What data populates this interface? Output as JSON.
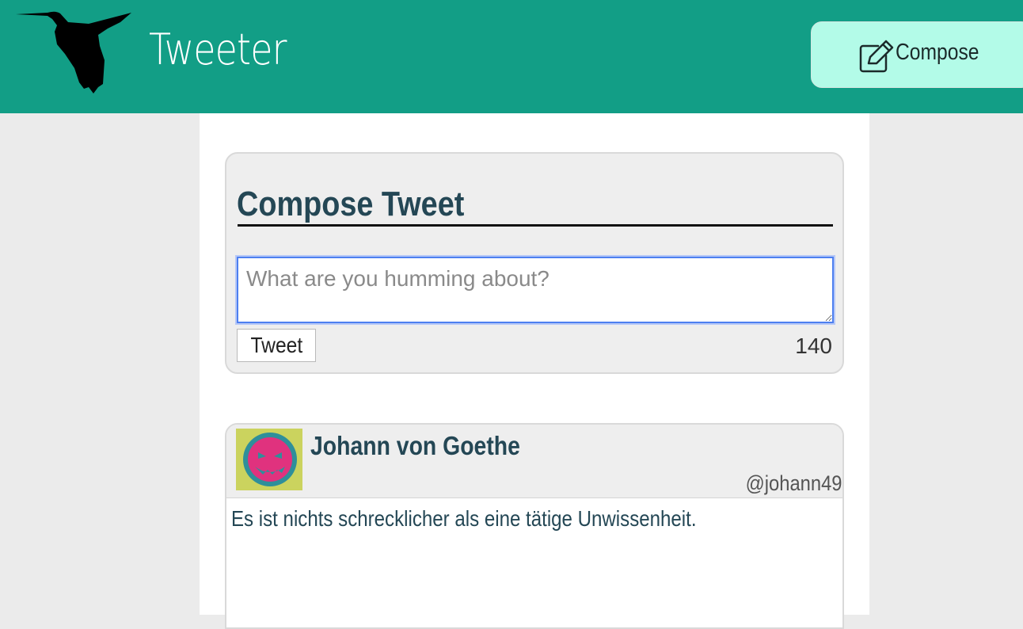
{
  "navbar": {
    "brand": "Tweeter",
    "logo_icon": "hummingbird-icon",
    "compose_button": {
      "label": "Compose",
      "icon": "pencil-square-icon"
    },
    "background_color": "#129e86",
    "compose_button_color": "#b3fbe8"
  },
  "compose_form": {
    "title": "Compose Tweet",
    "placeholder": "What are you humming about?",
    "value": "",
    "submit_label": "Tweet",
    "char_counter": "140"
  },
  "tweets": [
    {
      "author_name": "Johann von Goethe",
      "handle": "@johann49",
      "text": "Es ist nichts schrecklicher als eine tätige Unwissenheit.",
      "avatar_icon": "monster-face-avatar"
    }
  ],
  "colors": {
    "heading": "#244755",
    "page_background": "#ebebeb",
    "panel_background": "#eeeeee"
  }
}
